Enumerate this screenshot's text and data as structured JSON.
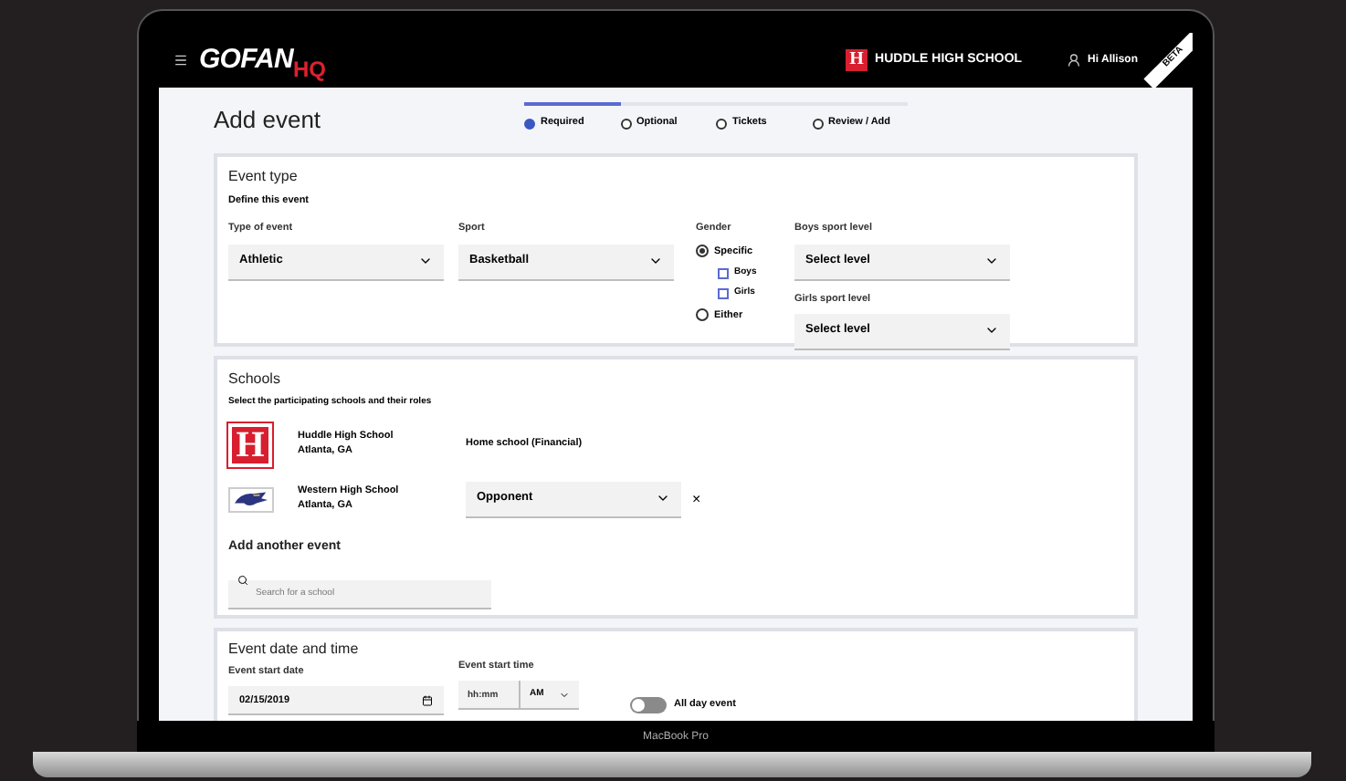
{
  "device": {
    "label": "MacBook Pro"
  },
  "header": {
    "logo_main": "GOFAN",
    "logo_accent": "HQ",
    "school_letter": "H",
    "school_name": "HUDDLE HIGH SCHOOL",
    "greeting": "Hi Allison",
    "badge": "BETA"
  },
  "page": {
    "title": "Add event"
  },
  "steps": [
    {
      "label": "Required",
      "selected": true
    },
    {
      "label": "Optional",
      "selected": false
    },
    {
      "label": "Tickets",
      "selected": false
    },
    {
      "label": "Review / Add",
      "selected": false
    }
  ],
  "event_type": {
    "title": "Event type",
    "subtitle": "Define this event",
    "type_of_event": {
      "label": "Type of event",
      "value": "Athletic"
    },
    "sport": {
      "label": "Sport",
      "value": "Basketball"
    },
    "gender": {
      "label": "Gender",
      "options": [
        {
          "label": "Specific",
          "selected": true,
          "children": [
            {
              "label": "Boys",
              "checked": false
            },
            {
              "label": "Girls",
              "checked": false
            }
          ]
        },
        {
          "label": "Either",
          "selected": false
        }
      ]
    },
    "levels": [
      {
        "label": "Boys sport level",
        "value": "Select level"
      },
      {
        "label": "Girls sport level",
        "value": "Select level"
      }
    ]
  },
  "schools": {
    "title": "Schools",
    "subtitle": "Select the participating schools and their roles",
    "rows": [
      {
        "logo": {
          "kind": "letter",
          "letter": "H"
        },
        "name": "Huddle High School",
        "location": "Atlanta, GA",
        "role": {
          "kind": "text",
          "value": "Home school (Financial)"
        }
      },
      {
        "logo": {
          "kind": "mascot"
        },
        "name": "Western High School",
        "location": "Atlanta, GA",
        "role": {
          "kind": "select",
          "value": "Opponent"
        },
        "remove": "×"
      }
    ],
    "add_title": "Add another event",
    "search": {
      "placeholder": "Search for a school"
    }
  },
  "date_time": {
    "title": "Event date and time",
    "start_date": {
      "label": "Event start date",
      "value": "02/15/2019"
    },
    "start_time": {
      "label": "Event start time",
      "placeholder": "hh:mm",
      "period": "AM"
    },
    "all_day": {
      "label": "All day event",
      "on": false
    }
  }
}
